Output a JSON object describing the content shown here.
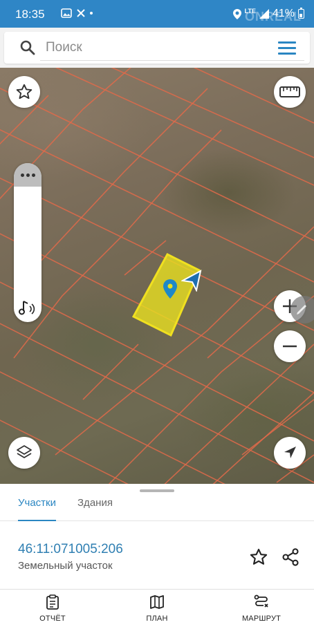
{
  "status_bar": {
    "time": "18:35",
    "network": "LTE",
    "battery": "41%",
    "watermark": "ONREAL"
  },
  "search": {
    "placeholder": "Поиск"
  },
  "map": {
    "parcel_outline_color": "#e06a4a",
    "selected_parcel_color": "#f0e020",
    "marker_color": "#1e88c8"
  },
  "sheet": {
    "tabs": [
      {
        "label": "Участки",
        "active": true
      },
      {
        "label": "Здания",
        "active": false
      }
    ],
    "parcel": {
      "cadastral_number": "46:11:071005:206",
      "type": "Земельный участок"
    }
  },
  "bottom_nav": {
    "items": [
      {
        "label": "ОТЧЁТ",
        "icon": "report-icon"
      },
      {
        "label": "ПЛАН",
        "icon": "map-plan-icon"
      },
      {
        "label": "МАРШРУТ",
        "icon": "route-icon"
      }
    ]
  },
  "colors": {
    "accent": "#2a86c2",
    "status_bar": "#2f86c6"
  }
}
